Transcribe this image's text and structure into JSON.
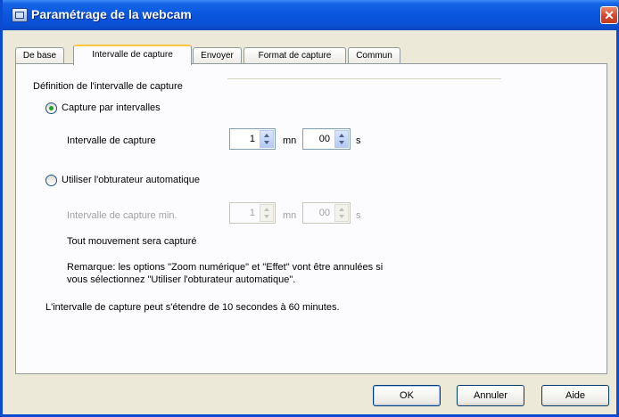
{
  "window": {
    "title": "Paramétrage de la webcam",
    "close_glyph": "✕"
  },
  "tabs": [
    "De base",
    "Intervalle de capture",
    "Envoyer",
    "Format de capture",
    "Commun"
  ],
  "active_tab": "Intervalle de capture",
  "group": {
    "title": "Définition de l'intervalle de capture"
  },
  "option_interval": {
    "label": "Capture par intervalles",
    "checked": true,
    "interval_label": "Intervalle de capture",
    "minutes": "1",
    "minutes_unit": "mn",
    "seconds": "00",
    "seconds_unit": "s"
  },
  "option_auto": {
    "label": "Utiliser l'obturateur automatique",
    "checked": false,
    "min_interval_label": "Intervalle de capture min.",
    "minutes": "1",
    "minutes_unit": "mn",
    "seconds": "00",
    "seconds_unit": "s",
    "movement_note": "Tout mouvement sera capturé",
    "remark_line1": "Remarque: les options \"Zoom numérique\" et \"Effet\" vont être annulées si",
    "remark_line2": "vous sélectionnez \"Utiliser l'obturateur automatique\"."
  },
  "range_note": "L'intervalle de capture peut s'étendre de 10 secondes à 60 minutes.",
  "buttons": {
    "ok": "OK",
    "cancel": "Annuler",
    "help": "Aide"
  }
}
